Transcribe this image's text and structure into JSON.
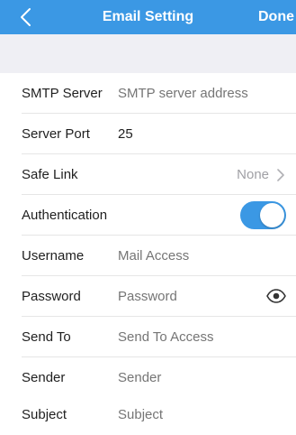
{
  "nav": {
    "back_icon": "chevron-left-icon",
    "title": "Email Setting",
    "done_label": "Done"
  },
  "colors": {
    "accent": "#3b98e4",
    "background_gap": "#efeff4",
    "placeholder": "#c8c8cc"
  },
  "form": {
    "smtp_server": {
      "label": "SMTP Server",
      "value": "",
      "placeholder": "SMTP server address"
    },
    "server_port": {
      "label": "Server Port",
      "value": "25"
    },
    "safe_link": {
      "label": "Safe Link",
      "value": "None",
      "icon": "chevron-right-icon"
    },
    "authentication": {
      "label": "Authentication",
      "enabled": true
    },
    "username": {
      "label": "Username",
      "value": "",
      "placeholder": "Mail Access"
    },
    "password": {
      "label": "Password",
      "value": "",
      "placeholder": "Password",
      "icon": "eye-icon"
    },
    "send_to": {
      "label": "Send To",
      "value": "",
      "placeholder": "Send To Access"
    },
    "sender": {
      "label": "Sender",
      "value": "",
      "placeholder": "Sender"
    },
    "subject": {
      "label": "Subject",
      "value": "",
      "placeholder": "Subject"
    }
  }
}
